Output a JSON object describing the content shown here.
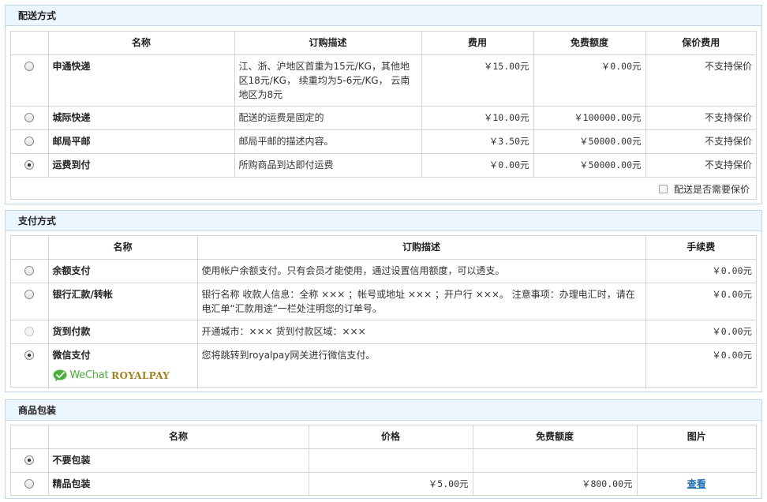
{
  "shipping": {
    "title": "配送方式",
    "headers": [
      "名称",
      "订购描述",
      "费用",
      "免费额度",
      "保价费用"
    ],
    "rows": [
      {
        "name": "申通快递",
        "desc": "江、浙、沪地区首重为15元/KG，其他地区18元/KG， 续重均为5-6元/KG， 云南地区为8元",
        "fee": "￥15.00元",
        "free": "￥0.00元",
        "insure": "不支持保价",
        "checked": false
      },
      {
        "name": "城际快递",
        "desc": "配送的运费是固定的",
        "fee": "￥10.00元",
        "free": "￥100000.00元",
        "insure": "不支持保价",
        "checked": false
      },
      {
        "name": "邮局平邮",
        "desc": "邮局平邮的描述内容。",
        "fee": "￥3.50元",
        "free": "￥50000.00元",
        "insure": "不支持保价",
        "checked": false
      },
      {
        "name": "运费到付",
        "desc": "所购商品到达即付运费",
        "fee": "￥0.00元",
        "free": "￥50000.00元",
        "insure": "不支持保价",
        "checked": true
      }
    ],
    "insure_label": "配送是否需要保价"
  },
  "payment": {
    "title": "支付方式",
    "headers": [
      "名称",
      "订购描述",
      "手续费"
    ],
    "rows": [
      {
        "name": "余额支付",
        "desc": "使用帐户余额支付。只有会员才能使用，通过设置信用额度，可以透支。",
        "fee": "￥0.00元",
        "checked": false,
        "disabled": false
      },
      {
        "name": "银行汇款/转帐",
        "desc": "银行名称 收款人信息：全称 ××× ；帐号或地址 ××× ；开户行 ×××。 注意事项：办理电汇时，请在电汇单“汇款用途”一栏处注明您的订单号。",
        "fee": "￥0.00元",
        "checked": false,
        "disabled": false
      },
      {
        "name": "货到付款",
        "desc": "开通城市：××× 货到付款区域：×××",
        "fee": "￥0.00元",
        "checked": false,
        "disabled": true
      },
      {
        "name": "微信支付",
        "desc": "您将跳转到royalpay网关进行微信支付。",
        "fee": "￥0.00元",
        "checked": true,
        "disabled": false
      }
    ],
    "logo": {
      "wechat": "WeChat",
      "royalpay": "ROYALPAY",
      "icon": "wechat-icon",
      "brand_color": "#4caf3b",
      "royal_color": "#a5801f"
    }
  },
  "packaging": {
    "title": "商品包装",
    "headers": [
      "名称",
      "价格",
      "免费额度",
      "图片"
    ],
    "rows": [
      {
        "name": "不要包装",
        "price": "",
        "free": "",
        "image": "",
        "checked": true
      },
      {
        "name": "精品包装",
        "price": "￥5.00元",
        "free": "￥800.00元",
        "image": "查看",
        "checked": false
      }
    ]
  },
  "colors": {
    "panel_border": "#bcd8ea",
    "panel_head_bg": "#eaf5fd",
    "link": "#1e6fb5"
  }
}
